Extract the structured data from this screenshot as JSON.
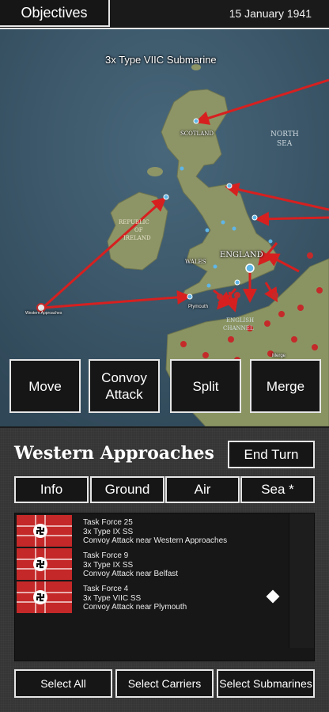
{
  "header": {
    "objectives_label": "Objectives",
    "date": "15 January 1941"
  },
  "map": {
    "unit_label": "3x Type VIIC Submarine",
    "places": {
      "scotland": "SCOTLAND",
      "north_sea": "NORTH",
      "north_sea_2": "SEA",
      "ireland_1": "REPUBLIC",
      "ireland_2": "OF",
      "ireland_3": "IRELAND",
      "wales": "WALES",
      "england": "ENGLAND",
      "channel_1": "ENGLISH",
      "channel_2": "CHANNEL",
      "plymouth": "Plymouth",
      "western_approaches": "Western Approaches",
      "merge": "Merge"
    },
    "colors": {
      "sea": "#3d5769",
      "land": "#8c9468",
      "arrow": "#d62020"
    }
  },
  "actions": {
    "move": "Move",
    "convoy_attack_1": "Convoy",
    "convoy_attack_2": "Attack",
    "split": "Split",
    "merge": "Merge"
  },
  "panel": {
    "region_title": "Western Approaches",
    "end_turn": "End Turn",
    "tabs": [
      "Info",
      "Ground",
      "Air",
      "Sea *"
    ],
    "forces": [
      {
        "name": "Task Force 25",
        "units": "3x Type IX SS",
        "mission": "Convoy Attack near Western Approaches",
        "selected": false
      },
      {
        "name": "Task Force 9",
        "units": "3x Type IX SS",
        "mission": "Convoy Attack near Belfast",
        "selected": false
      },
      {
        "name": "Task Force 4",
        "units": "3x Type VIIC SS",
        "mission": "Convoy Attack near Plymouth",
        "selected": true
      }
    ],
    "select_all": "Select All",
    "select_carriers": "Select Carriers",
    "select_submarines": "Select Submarines"
  }
}
